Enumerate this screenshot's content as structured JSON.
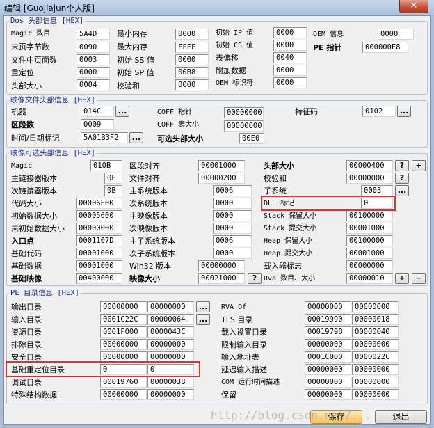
{
  "window": {
    "title": "编辑 [Guojiajun个人版]",
    "close_symbol": "✕"
  },
  "groups": {
    "dos": "Dos 头部信息 [HEX]",
    "file": "映像文件头部信息 [HEX]",
    "optional": "映像可选头部信息 [HEX]",
    "pe_dir": "PE 目录信息 [HEX]"
  },
  "dos": {
    "magic_label": "Magic 数目",
    "magic": "5A4D",
    "last_page_label": "末页字节数",
    "last_page": "0090",
    "pages_label": "文件中页面数",
    "pages": "0003",
    "reloc_label": "重定位",
    "reloc": "0000",
    "header_size_label": "头部大小",
    "header_size": "0004",
    "min_mem_label": "最小内存",
    "min_mem": "0000",
    "max_mem_label": "最大内存",
    "max_mem": "FFFF",
    "init_ss_label": "初始 SS 值",
    "init_ss": "0000",
    "init_sp_label": "初始 SP 值",
    "init_sp": "00B8",
    "checksum_label": "校验和",
    "checksum": "0000",
    "init_ip_label": "初始 IP 值",
    "init_ip": "0000",
    "init_cs_label": "初始 CS 值",
    "init_cs": "0000",
    "table_offset_label": "表偏移",
    "table_offset": "0040",
    "overlay_label": "附加数据",
    "overlay": "0000",
    "oem_id_label": "OEM 标识符",
    "oem_id": "0000",
    "oem_info_label": "OEM 信息",
    "oem_info": "0000",
    "pe_pointer_label": "PE 指针",
    "pe_pointer": "000000E8"
  },
  "file_header": {
    "machine_label": "机器",
    "machine": "014C",
    "sections_label": "区段数",
    "sections": "0009",
    "timestamp_label": "时间/日期标记",
    "timestamp": "5A01B3F2",
    "coff_ptr_label": "COFF 指针",
    "coff_ptr": "00000000",
    "coff_size_label": "COFF 表大小",
    "coff_size": "00000000",
    "opt_size_label": "可选头部大小",
    "opt_size": "00E0",
    "characteristics_label": "特征码",
    "characteristics": "0102"
  },
  "optional": {
    "magic_label": "Magic",
    "magic": "010B",
    "major_linker_label": "主链接器版本",
    "major_linker": "0E",
    "minor_linker_label": "次链接器版本",
    "minor_linker": "0B",
    "code_size_label": "代码大小",
    "code_size": "00006E00",
    "init_data_label": "初始数据大小",
    "init_data": "00005600",
    "uninit_data_label": "未初始数据大小",
    "uninit_data": "00000000",
    "entry_label": "入口点",
    "entry": "0001107D",
    "base_code_label": "基础代码",
    "base_code": "00001000",
    "base_data_label": "基础数据",
    "base_data": "00001000",
    "image_base_label": "基础映像",
    "image_base": "00400000",
    "section_align_label": "区段对齐",
    "section_align": "00001000",
    "file_align_label": "文件对齐",
    "file_align": "00000200",
    "major_os_label": "主系统版本",
    "major_os": "0006",
    "minor_os_label": "次系统版本",
    "minor_os": "0000",
    "major_image_label": "主映像版本",
    "major_image": "0000",
    "minor_image_label": "次映像版本",
    "minor_image": "0000",
    "major_subsys_label": "主子系统版本",
    "major_subsys": "0006",
    "minor_subsys_label": "次子系统版本",
    "minor_subsys": "0000",
    "win32_label": "Win32 版本",
    "win32": "00000000",
    "image_size_label": "映像大小",
    "image_size": "00021000",
    "headers_size_label": "头部大小",
    "headers_size": "00000400",
    "checksum_label": "校验和",
    "checksum": "00000000",
    "subsystem_label": "子系统",
    "subsystem": "0003",
    "dll_label": "DLL 标记",
    "dll": "0",
    "stack_reserve_label": "Stack 保留大小",
    "stack_reserve": "00100000",
    "stack_commit_label": "Stack 提交大小",
    "stack_commit": "00001000",
    "heap_reserve_label": "Heap 保留大小",
    "heap_reserve": "00100000",
    "heap_commit_label": "Heap 提交大小",
    "heap_commit": "00001000",
    "loader_flags_label": "载入器标志",
    "loader_flags": "00000000",
    "rva_count_label": "Rva 数目、大小",
    "rva_count": "00000010"
  },
  "directories_left": [
    {
      "label": "输出目录",
      "rva": "00000000",
      "size": "00000000",
      "has_button": true
    },
    {
      "label": "输入目录",
      "rva": "0001C22C",
      "size": "00000064",
      "has_button": true
    },
    {
      "label": "资源目录",
      "rva": "0001F000",
      "size": "0000043C",
      "has_button": false
    },
    {
      "label": "排除目录",
      "rva": "00000000",
      "size": "00000000",
      "has_button": false
    },
    {
      "label": "安全目录",
      "rva": "00000000",
      "size": "00000000",
      "has_button": false
    },
    {
      "label": "基础重定位目录",
      "rva": "0",
      "size": "0",
      "has_button": false
    },
    {
      "label": "调试目录",
      "rva": "00019760",
      "size": "00000038",
      "has_button": false
    },
    {
      "label": "特殊结构数据",
      "rva": "00000000",
      "size": "00000000",
      "has_button": false
    }
  ],
  "directories_right": [
    {
      "label": "RVA Of",
      "rva": "00000000",
      "size": "00000000"
    },
    {
      "label": "TLS 目录",
      "rva": "00019990",
      "size": "00000018"
    },
    {
      "label": "载入设置目录",
      "rva": "00019798",
      "size": "00000040"
    },
    {
      "label": "限制输入目录",
      "rva": "00000000",
      "size": "00000000"
    },
    {
      "label": "输入地址表",
      "rva": "0001C000",
      "size": "0000022C"
    },
    {
      "label": "延迟输入描述",
      "rva": "00000000",
      "size": "00000000"
    },
    {
      "label": "COM 运行时间描述",
      "rva": "00000000",
      "size": "00000000"
    },
    {
      "label": "保留",
      "rva": "00000000",
      "size": "00000000"
    }
  ],
  "buttons": {
    "more": "...",
    "help": "?",
    "plus": "+",
    "minus": "−",
    "save": "保存",
    "exit": "退出"
  },
  "watermark": "http://blog.csdn.net/...",
  "colors": {
    "group_title": "#1a2a88",
    "highlight": "#e03030",
    "primary_button": "#f6c25c"
  }
}
